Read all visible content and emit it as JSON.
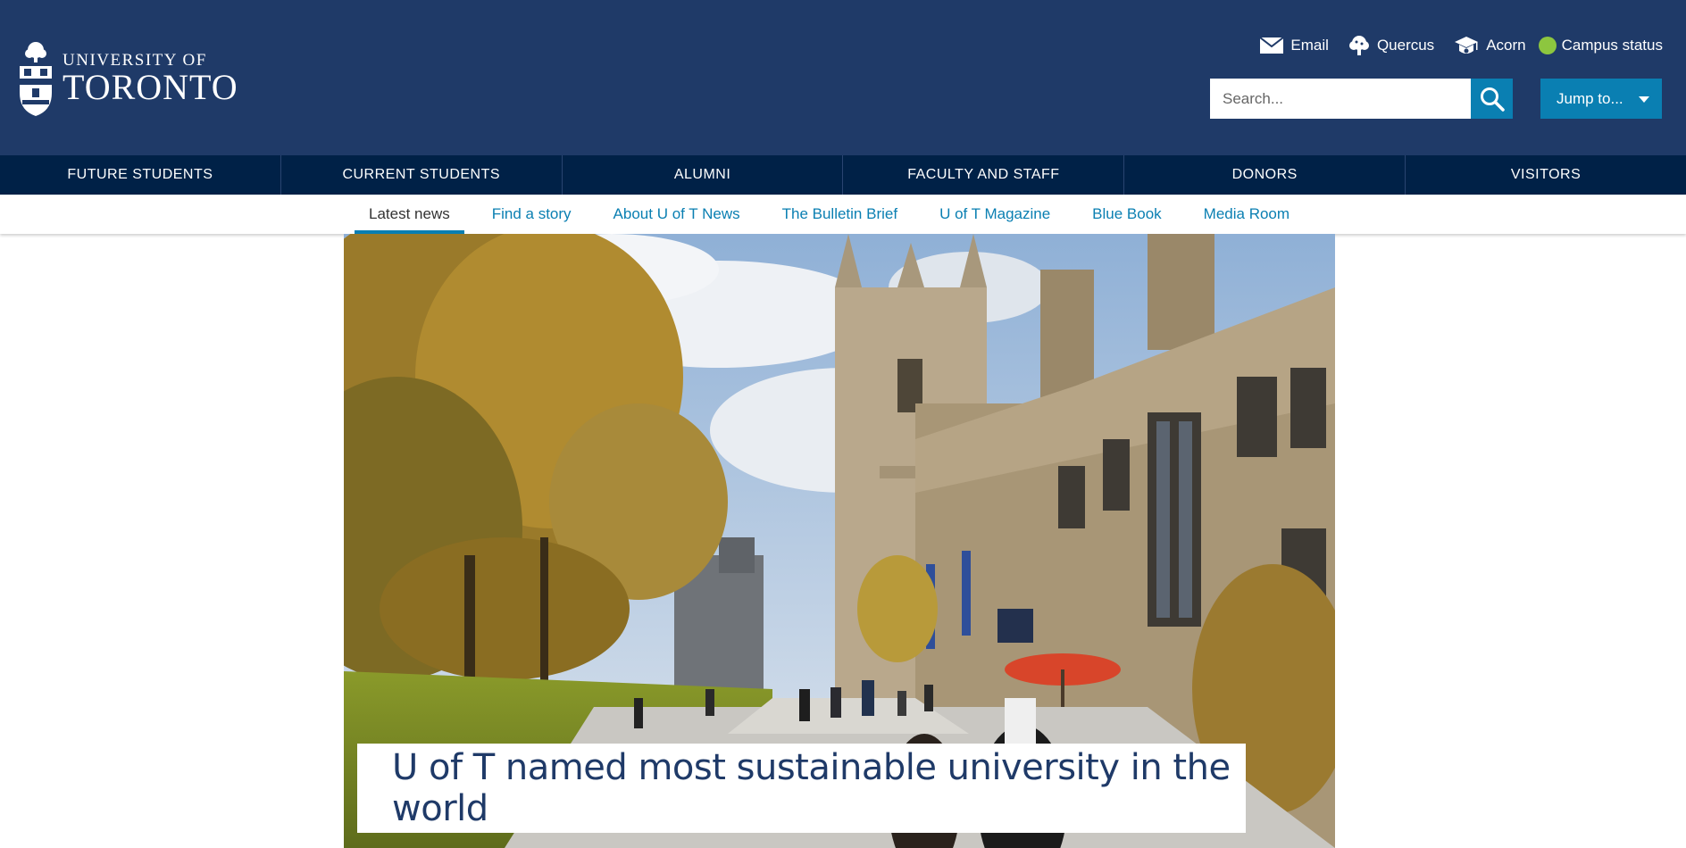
{
  "header": {
    "logo_line1": "UNIVERSITY OF",
    "logo_line2": "TORONTO",
    "quick_links": [
      {
        "label": "Email",
        "icon": "envelope-icon"
      },
      {
        "label": "Quercus",
        "icon": "quercus-tree-icon"
      },
      {
        "label": "Acorn",
        "icon": "graduation-cap-icon"
      },
      {
        "label": "Campus status",
        "icon": "status-dot-icon"
      }
    ],
    "search": {
      "placeholder": "Search...",
      "value": ""
    },
    "jump_label": "Jump to..."
  },
  "audience_nav": [
    {
      "label": "FUTURE STUDENTS"
    },
    {
      "label": "CURRENT STUDENTS"
    },
    {
      "label": "ALUMNI"
    },
    {
      "label": "FACULTY AND STAFF"
    },
    {
      "label": "DONORS"
    },
    {
      "label": "VISITORS"
    }
  ],
  "sub_nav": [
    {
      "label": "Latest news",
      "active": true
    },
    {
      "label": "Find a story",
      "active": false
    },
    {
      "label": "About U of T News",
      "active": false
    },
    {
      "label": "The Bulletin Brief",
      "active": false
    },
    {
      "label": "U of T Magazine",
      "active": false
    },
    {
      "label": "Blue Book",
      "active": false
    },
    {
      "label": "Media Room",
      "active": false
    }
  ],
  "hero": {
    "title": "U of T named most sustainable university in the world"
  },
  "colors": {
    "header_bg": "#1f3a68",
    "audience_bg": "#002147",
    "accent": "#0a7fb2",
    "status_green": "#8dc63f"
  }
}
